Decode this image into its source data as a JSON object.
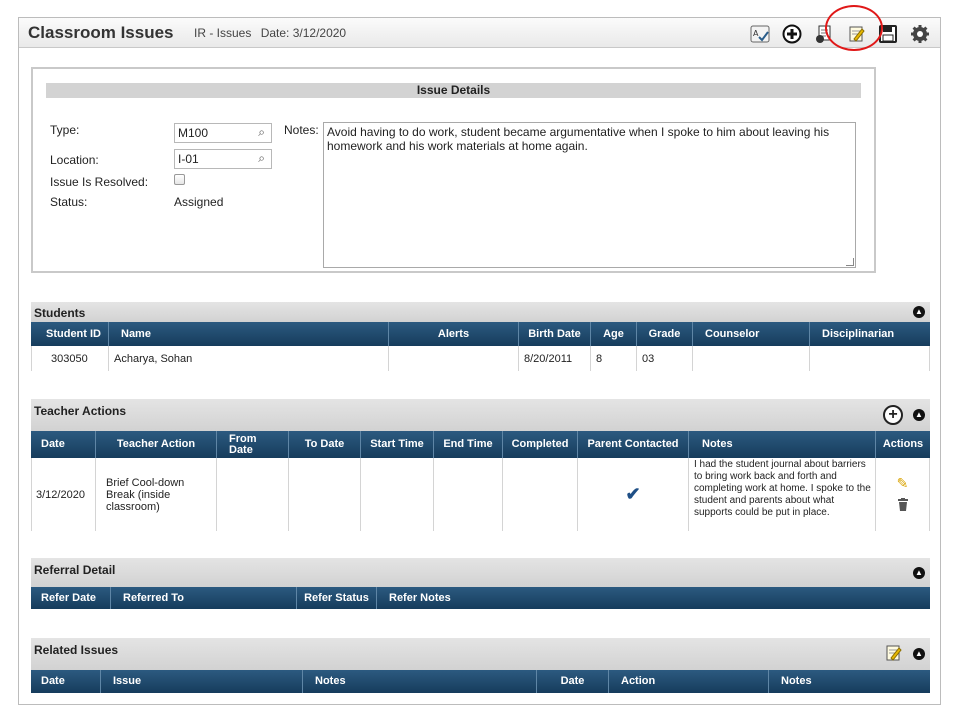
{
  "window": {
    "title": "Classroom Issues",
    "subtitle_type": "IR - Issues",
    "subtitle_date": "Date: 3/12/2020"
  },
  "toolbar": {
    "icons": [
      "spellcheck-icon",
      "add-icon",
      "print-report-icon",
      "edit-notes-icon",
      "save-icon",
      "settings-icon"
    ]
  },
  "issue_details": {
    "heading": "Issue Details",
    "type_label": "Type:",
    "type_value": "M100",
    "location_label": "Location:",
    "location_value": "I-01",
    "resolved_label": "Issue Is Resolved:",
    "status_label": "Status:",
    "status_value": "Assigned",
    "notes_label": "Notes:",
    "notes_value": "Avoid having to do work, student became argumentative when I spoke to him about leaving his homework and his work materials at home again."
  },
  "students": {
    "title": "Students",
    "columns": [
      "Student ID",
      "Name",
      "Alerts",
      "Birth Date",
      "Age",
      "Grade",
      "Counselor",
      "Disciplinarian"
    ],
    "rows": [
      {
        "id": "303050",
        "name": "Acharya, Sohan",
        "alerts": "",
        "birth_date": "8/20/2011",
        "age": "8",
        "grade": "03",
        "counselor": "",
        "disciplinarian": ""
      }
    ]
  },
  "teacher_actions": {
    "title": "Teacher Actions",
    "columns": [
      "Date",
      "Teacher Action",
      "From Date",
      "To Date",
      "Start Time",
      "End Time",
      "Completed",
      "Parent Contacted",
      "Notes",
      "Actions"
    ],
    "rows": [
      {
        "date": "3/12/2020",
        "action": "Brief Cool-down Break (inside classroom)",
        "notes": "I had the student journal about barriers to bring work back and forth and completing work at home. I spoke to the student and parents about what supports could be put in place."
      }
    ]
  },
  "referral_detail": {
    "title": "Referral Detail",
    "columns": [
      "Refer Date",
      "Referred To",
      "Refer Status",
      "Refer Notes"
    ]
  },
  "related_issues": {
    "title": "Related Issues",
    "columns": [
      "Date",
      "Issue",
      "Notes",
      "Date",
      "Action",
      "Notes"
    ]
  }
}
